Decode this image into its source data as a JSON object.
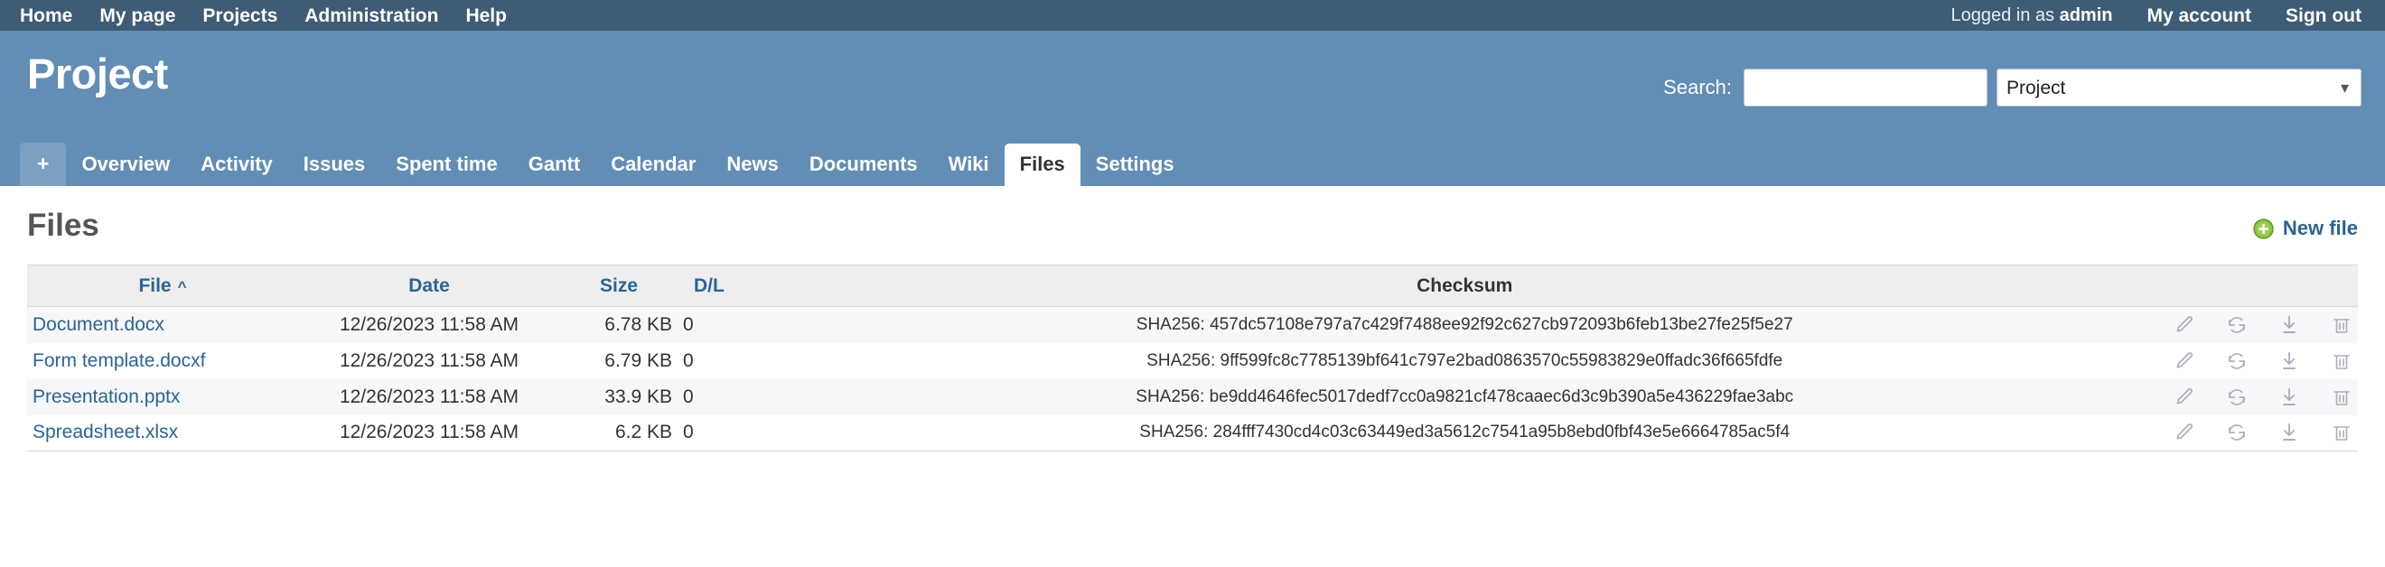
{
  "top_menu": {
    "left_items": [
      {
        "label": "Home"
      },
      {
        "label": "My page"
      },
      {
        "label": "Projects"
      },
      {
        "label": "Administration"
      },
      {
        "label": "Help"
      }
    ],
    "logged_in_prefix": "Logged in as ",
    "logged_in_user": "admin",
    "account_label": "My account",
    "signout_label": "Sign out"
  },
  "header": {
    "project_title": "Project",
    "search_label": "Search:",
    "search_value": "",
    "search_placeholder": "",
    "search_scope_selected": "Project",
    "search_scope_options": [
      "Project"
    ],
    "chevron_icon": "chevron-down-icon"
  },
  "tabs": {
    "add_label": "+",
    "items": [
      {
        "label": "Overview",
        "selected": false
      },
      {
        "label": "Activity",
        "selected": false
      },
      {
        "label": "Issues",
        "selected": false
      },
      {
        "label": "Spent time",
        "selected": false
      },
      {
        "label": "Gantt",
        "selected": false
      },
      {
        "label": "Calendar",
        "selected": false
      },
      {
        "label": "News",
        "selected": false
      },
      {
        "label": "Documents",
        "selected": false
      },
      {
        "label": "Wiki",
        "selected": false
      },
      {
        "label": "Files",
        "selected": true
      },
      {
        "label": "Settings",
        "selected": false
      }
    ]
  },
  "content": {
    "page_title": "Files",
    "new_file_label": "New file",
    "new_file_icon": "plus-circle-icon"
  },
  "table": {
    "columns": [
      {
        "label": "File",
        "sortable": true,
        "sort_indicator": "^"
      },
      {
        "label": "Date",
        "sortable": true,
        "sort_indicator": ""
      },
      {
        "label": "Size",
        "sortable": true,
        "sort_indicator": ""
      },
      {
        "label": "D/L",
        "sortable": true,
        "sort_indicator": ""
      },
      {
        "label": "Checksum",
        "sortable": false,
        "sort_indicator": ""
      }
    ],
    "rows": [
      {
        "filename": "Document.docx",
        "date": "12/26/2023 11:58 AM",
        "size": "6.78 KB",
        "downloads": "0",
        "checksum": "SHA256: 457dc57108e797a7c429f7488ee92f92c627cb972093b6feb13be27fe25f5e27"
      },
      {
        "filename": "Form template.docxf",
        "date": "12/26/2023 11:58 AM",
        "size": "6.79 KB",
        "downloads": "0",
        "checksum": "SHA256: 9ff599fc8c7785139bf641c797e2bad0863570c55983829e0ffadc36f665fdfe"
      },
      {
        "filename": "Presentation.pptx",
        "date": "12/26/2023 11:58 AM",
        "size": "33.9 KB",
        "downloads": "0",
        "checksum": "SHA256: be9dd4646fec5017dedf7cc0a9821cf478caaec6d3c9b390a5e436229fae3abc"
      },
      {
        "filename": "Spreadsheet.xlsx",
        "date": "12/26/2023 11:58 AM",
        "size": "6.2 KB",
        "downloads": "0",
        "checksum": "SHA256: 284fff7430cd4c03c63449ed3a5612c7541a95b8ebd0fbf43e5e6664785ac5f4"
      }
    ],
    "row_actions": [
      {
        "icon": "pencil-icon"
      },
      {
        "icon": "refresh-icon"
      },
      {
        "icon": "download-icon"
      },
      {
        "icon": "trash-icon"
      }
    ]
  },
  "colors": {
    "top_bar": "#3e5c76",
    "header_band": "#628db5",
    "link": "#2a6496",
    "header_row": "#eeeeee",
    "row_alt": "#f6f7f8",
    "icon_gray": "#a9a9bb"
  }
}
